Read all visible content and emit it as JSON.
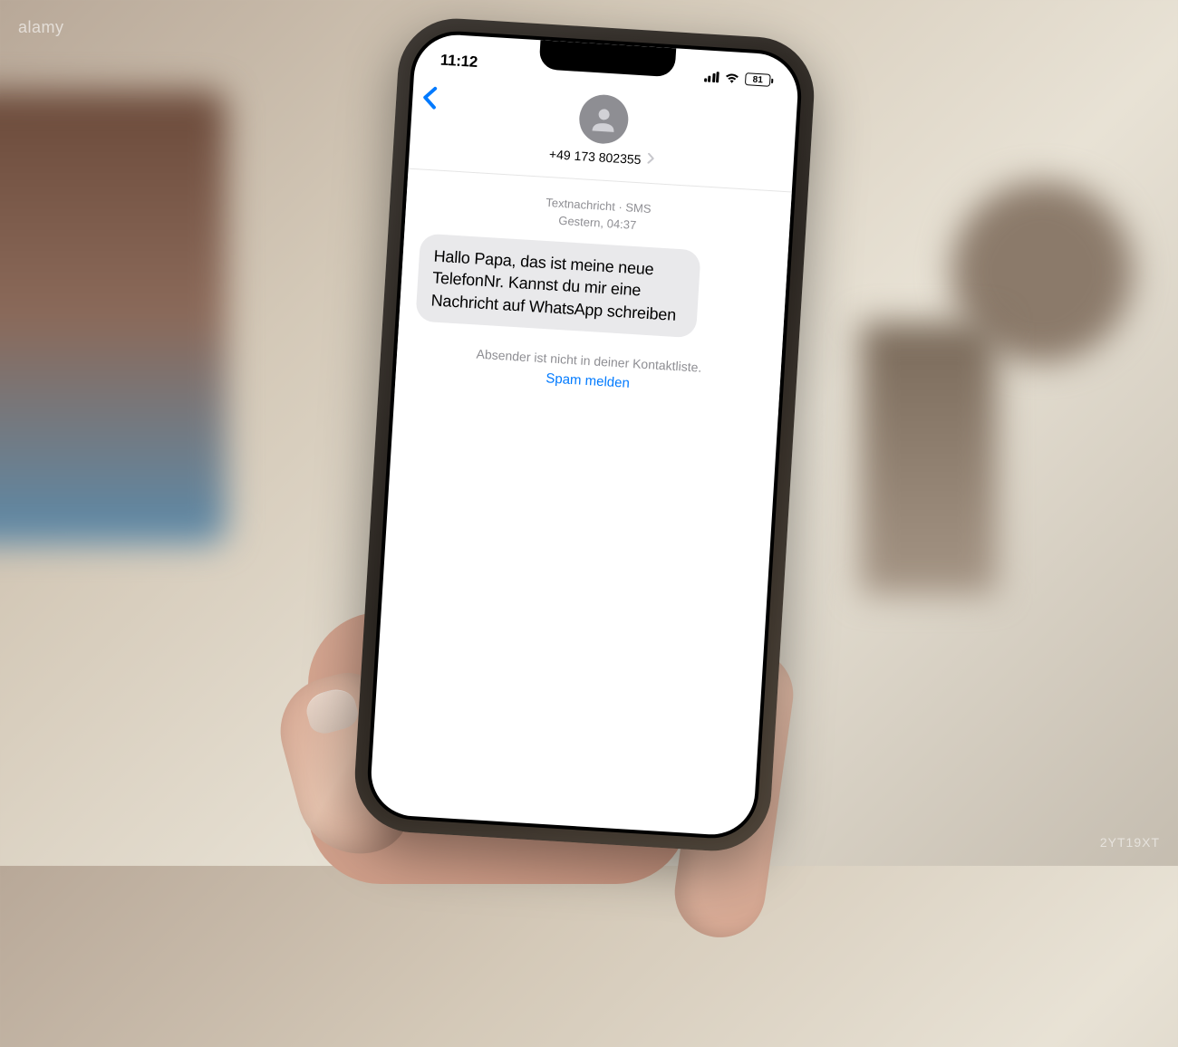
{
  "status_bar": {
    "time": "11:12",
    "battery": "81"
  },
  "contact": {
    "phone_number": "+49 173 802355"
  },
  "thread": {
    "type_label": "Textnachricht · SMS",
    "timestamp": "Gestern, 04:37",
    "message": "Hallo Papa, das ist meine neue TelefonNr. Kannst du mir eine Nachricht auf WhatsApp schreiben",
    "sender_notice": "Absender ist nicht in deiner Kontaktliste.",
    "spam_action": "Spam melden"
  },
  "watermark": {
    "brand": "alamy",
    "code": "2YT19XT"
  }
}
